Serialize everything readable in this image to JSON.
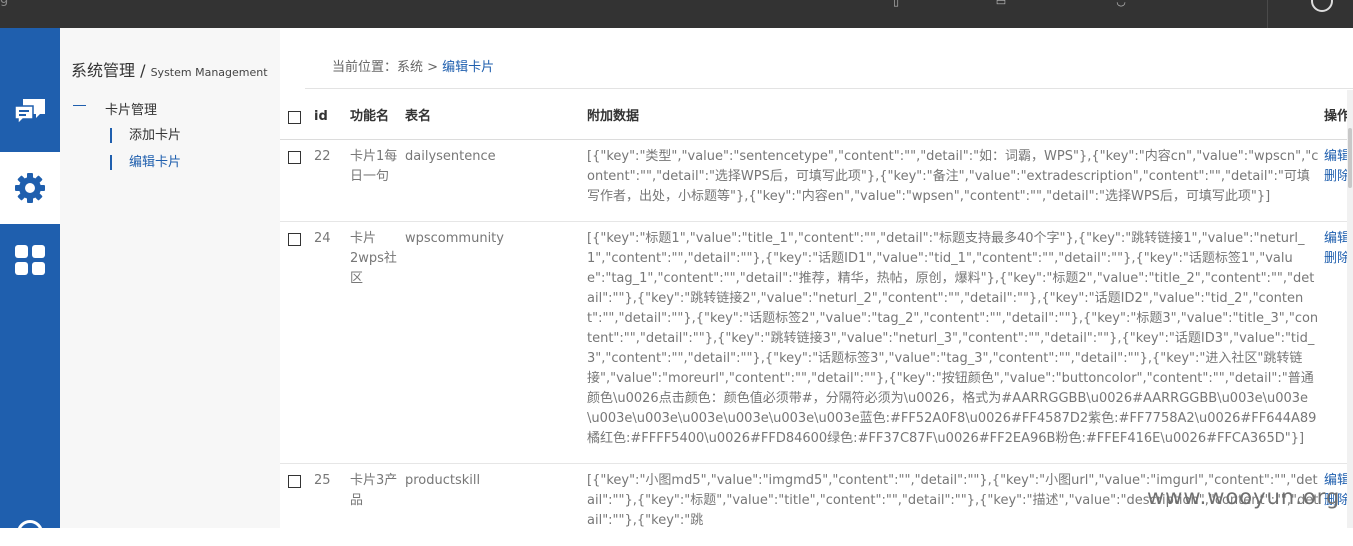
{
  "topbar": {
    "brand_fragment": "g",
    "icons": [
      "help-icon",
      "document-icon",
      "user-icon",
      "power-icon"
    ]
  },
  "iconbar": {
    "items": [
      "chat-icon",
      "gear-icon",
      "grid-icon"
    ],
    "active": "gear-icon"
  },
  "sidebar": {
    "title_cn": "系统管理 /",
    "title_en": "System Management",
    "group_label": "卡片管理",
    "items": [
      {
        "label": "添加卡片",
        "active": false
      },
      {
        "label": "编辑卡片",
        "active": true
      }
    ]
  },
  "breadcrumb": {
    "prefix": "当前位置：系统 >",
    "current": "编辑卡片"
  },
  "table": {
    "headers": {
      "id": "id",
      "function_name": "功能名",
      "table_name": "表名",
      "extra": "附加数据",
      "op": "操作"
    },
    "rows": [
      {
        "id": "22",
        "function_name": "卡片1每日一句",
        "table_name": "dailysentence",
        "extra": "[{\"key\":\"类型\",\"value\":\"sentencetype\",\"content\":\"\",\"detail\":\"如：词霸，WPS\"},{\"key\":\"内容cn\",\"value\":\"wpscn\",\"content\":\"\",\"detail\":\"选择WPS后，可填写此项\"},{\"key\":\"备注\",\"value\":\"extradescription\",\"content\":\"\",\"detail\":\"可填写作者，出处，小标题等\"},{\"key\":\"内容en\",\"value\":\"wpsen\",\"content\":\"\",\"detail\":\"选择WPS后，可填写此项\"}]",
        "op_edit": "编辑",
        "op_delete": "删除"
      },
      {
        "id": "24",
        "function_name": "卡片2wps社区",
        "table_name": "wpscommunity",
        "extra": "[{\"key\":\"标题1\",\"value\":\"title_1\",\"content\":\"\",\"detail\":\"标题支持最多40个字\"},{\"key\":\"跳转链接1\",\"value\":\"neturl_1\",\"content\":\"\",\"detail\":\"\"},{\"key\":\"话题ID1\",\"value\":\"tid_1\",\"content\":\"\",\"detail\":\"\"},{\"key\":\"话题标签1\",\"value\":\"tag_1\",\"content\":\"\",\"detail\":\"推荐，精华，热帖，原创，爆料\"},{\"key\":\"标题2\",\"value\":\"title_2\",\"content\":\"\",\"detail\":\"\"},{\"key\":\"跳转链接2\",\"value\":\"neturl_2\",\"content\":\"\",\"detail\":\"\"},{\"key\":\"话题ID2\",\"value\":\"tid_2\",\"content\":\"\",\"detail\":\"\"},{\"key\":\"话题标签2\",\"value\":\"tag_2\",\"content\":\"\",\"detail\":\"\"},{\"key\":\"标题3\",\"value\":\"title_3\",\"content\":\"\",\"detail\":\"\"},{\"key\":\"跳转链接3\",\"value\":\"neturl_3\",\"content\":\"\",\"detail\":\"\"},{\"key\":\"话题ID3\",\"value\":\"tid_3\",\"content\":\"\",\"detail\":\"\"},{\"key\":\"话题标签3\",\"value\":\"tag_3\",\"content\":\"\",\"detail\":\"\"},{\"key\":\"进入社区\"跳转链接\",\"value\":\"moreurl\",\"content\":\"\",\"detail\":\"\"},{\"key\":\"按钮颜色\",\"value\":\"buttoncolor\",\"content\":\"\",\"detail\":\"普通颜色\\u0026点击颜色：颜色值必须带#，分隔符必须为\\u0026，格式为#AARRGGBB\\u0026#AARRGGBB\\u003e\\u003e\\u003e\\u003e\\u003e\\u003e\\u003e\\u003e蓝色:#FF52A0F8\\u0026#FF4587D2紫色:#FF7758A2\\u0026#FF644A89橘红色:#FFFF5400\\u0026#FFD84600绿色:#FF37C87F\\u0026#FF2EA96B粉色:#FFEF416E\\u0026#FFCA365D\"}]",
        "op_edit": "编辑",
        "op_delete": "删除"
      },
      {
        "id": "25",
        "function_name": "卡片3产品",
        "table_name": "productskill",
        "extra": "[{\"key\":\"小图md5\",\"value\":\"imgmd5\",\"content\":\"\",\"detail\":\"\"},{\"key\":\"小图url\",\"value\":\"imgurl\",\"content\":\"\",\"detail\":\"\"},{\"key\":\"标题\",\"value\":\"title\",\"content\":\"\",\"detail\":\"\"},{\"key\":\"描述\",\"value\":\"description\",\"content\":\"\",\"detail\":\"\"},{\"key\":\"跳",
        "op_edit": "编辑",
        "op_delete": "删除"
      }
    ]
  },
  "watermark": "www.wooyun.org"
}
